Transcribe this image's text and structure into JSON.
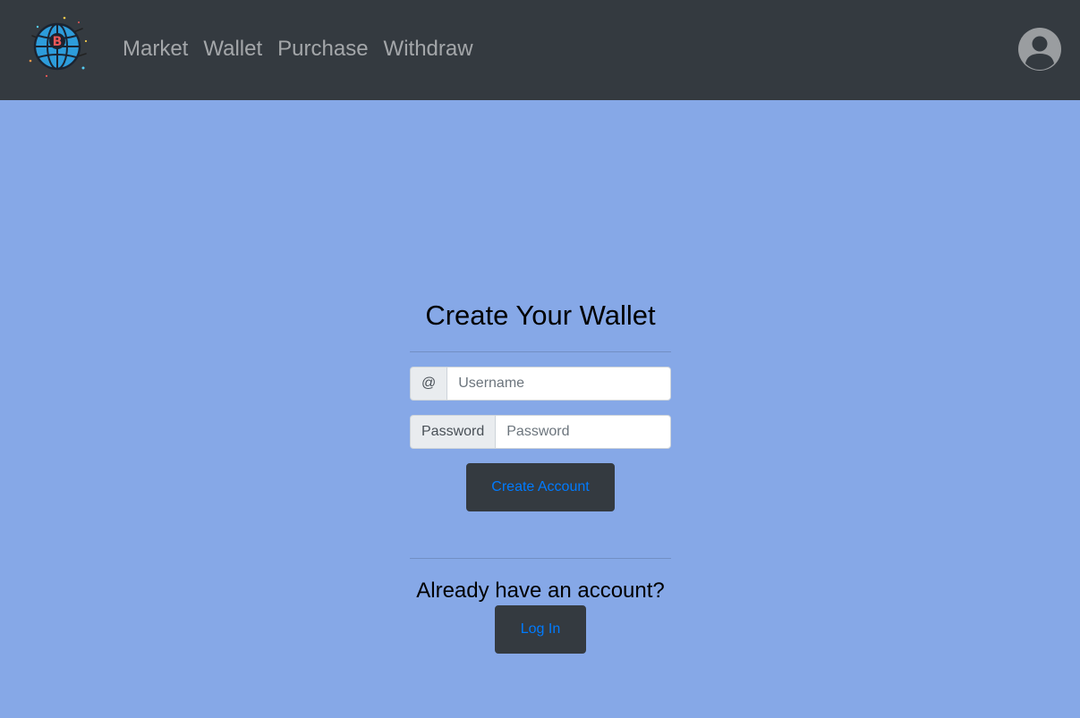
{
  "nav": {
    "links": [
      "Market",
      "Wallet",
      "Purchase",
      "Withdraw"
    ]
  },
  "form": {
    "title": "Create Your Wallet",
    "username_addon": "@",
    "username_placeholder": "Username",
    "password_addon": "Password",
    "password_placeholder": "Password",
    "create_label": "Create Account"
  },
  "login": {
    "prompt": "Already have an account?",
    "button_label": "Log In"
  },
  "colors": {
    "navbar_bg": "#343a40",
    "page_bg": "#86a8e7",
    "button_bg": "#343a40",
    "button_text": "#007bff",
    "nav_link": "#9a9da0"
  },
  "icons": {
    "logo": "globe-bitcoin-logo",
    "avatar": "user-circle-icon"
  }
}
